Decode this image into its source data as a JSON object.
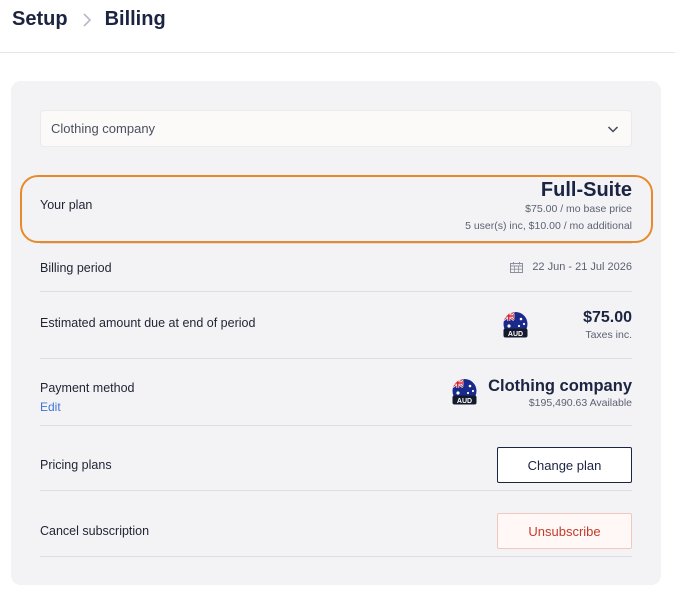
{
  "breadcrumb": {
    "parent": "Setup",
    "current": "Billing"
  },
  "account_select": {
    "value": "Clothing company"
  },
  "plan": {
    "label": "Your plan",
    "name": "Full-Suite",
    "base_price": "$75.00 / mo base price",
    "users_info": "5 user(s) inc, $10.00 / mo additional"
  },
  "billing_period": {
    "label": "Billing period",
    "value": "22 Jun - 21 Jul 2026"
  },
  "estimate": {
    "label": "Estimated amount due at end of period",
    "amount": "$75.00",
    "note": "Taxes inc.",
    "currency": "AUD"
  },
  "payment": {
    "label": "Payment method",
    "edit_label": "Edit",
    "account_name": "Clothing company",
    "available": "$195,490.63 Available",
    "currency": "AUD"
  },
  "pricing_plans": {
    "label": "Pricing plans",
    "button": "Change plan"
  },
  "cancel": {
    "label": "Cancel subscription",
    "button": "Unsubscribe"
  },
  "colors": {
    "highlight": "#e88a2b",
    "link": "#3f73d6",
    "danger": "#c43a2a",
    "navy": "#1b2440"
  }
}
